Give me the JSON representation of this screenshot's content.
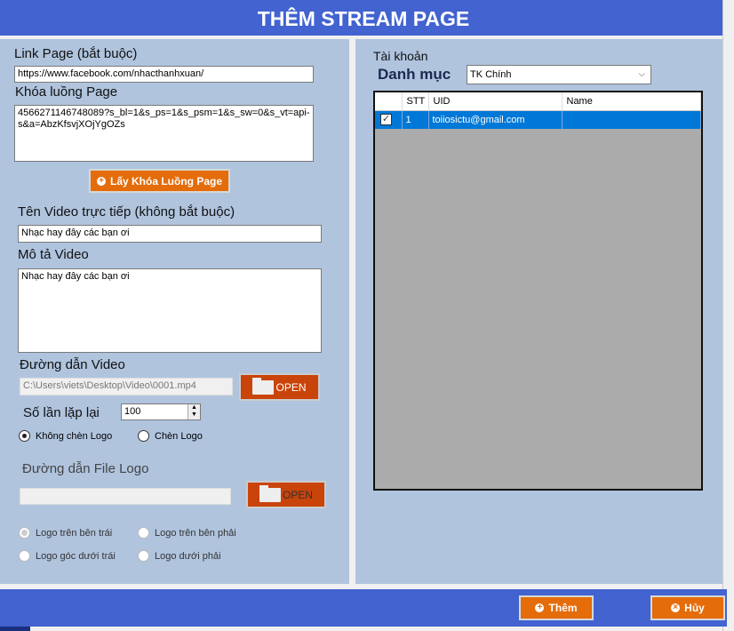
{
  "title": "THÊM STREAM PAGE",
  "left": {
    "link_label": "Link Page (bắt buộc)",
    "link_value": "https://www.facebook.com/nhacthanhxuan/",
    "key_label": "Khóa luồng Page",
    "key_value": "4566271146748089?s_bl=1&s_ps=1&s_psm=1&s_sw=0&s_vt=api-s&a=AbzKfsvjXOjYgOZs",
    "get_key_button": "Lấy Khóa Luồng Page",
    "video_name_label": "Tên Video trực tiếp (không bắt buộc)",
    "video_name_value": "Nhạc hay đây các bạn ơi",
    "desc_label": "Mô tả Video",
    "desc_value": "Nhạc hay đây các bạn ơi",
    "video_path_label": "Đường dẫn Video",
    "video_path_value": "C:\\Users\\viets\\Desktop\\Video\\0001.mp4",
    "open_label": "OPEN",
    "repeat_label": "Số lần lặp lại",
    "repeat_value": "100",
    "no_logo": "Không chèn Logo",
    "with_logo": "Chèn Logo",
    "logo_path_label": "Đường dẫn File Logo",
    "logo_path_value": "",
    "logo_positions": [
      "Logo trên bên trái",
      "Logo trên bên phải",
      "Logo góc dưới trái",
      "Logo dưới phải"
    ]
  },
  "right": {
    "account_label": "Tài khoản",
    "category_label": "Danh mục",
    "category_value": "TK Chính",
    "columns": [
      "STT",
      "UID",
      "Name"
    ],
    "rows": [
      {
        "checked": true,
        "stt": "1",
        "uid": "toiiosictu@gmail.com",
        "name": ""
      }
    ]
  },
  "footer": {
    "add_button": "Thêm",
    "cancel_button": "Hủy"
  },
  "colors": {
    "header": "#4263d0",
    "panel": "#b0c4de",
    "accent": "#e46c0a",
    "open": "#c9440a",
    "selection": "#0078d7"
  }
}
